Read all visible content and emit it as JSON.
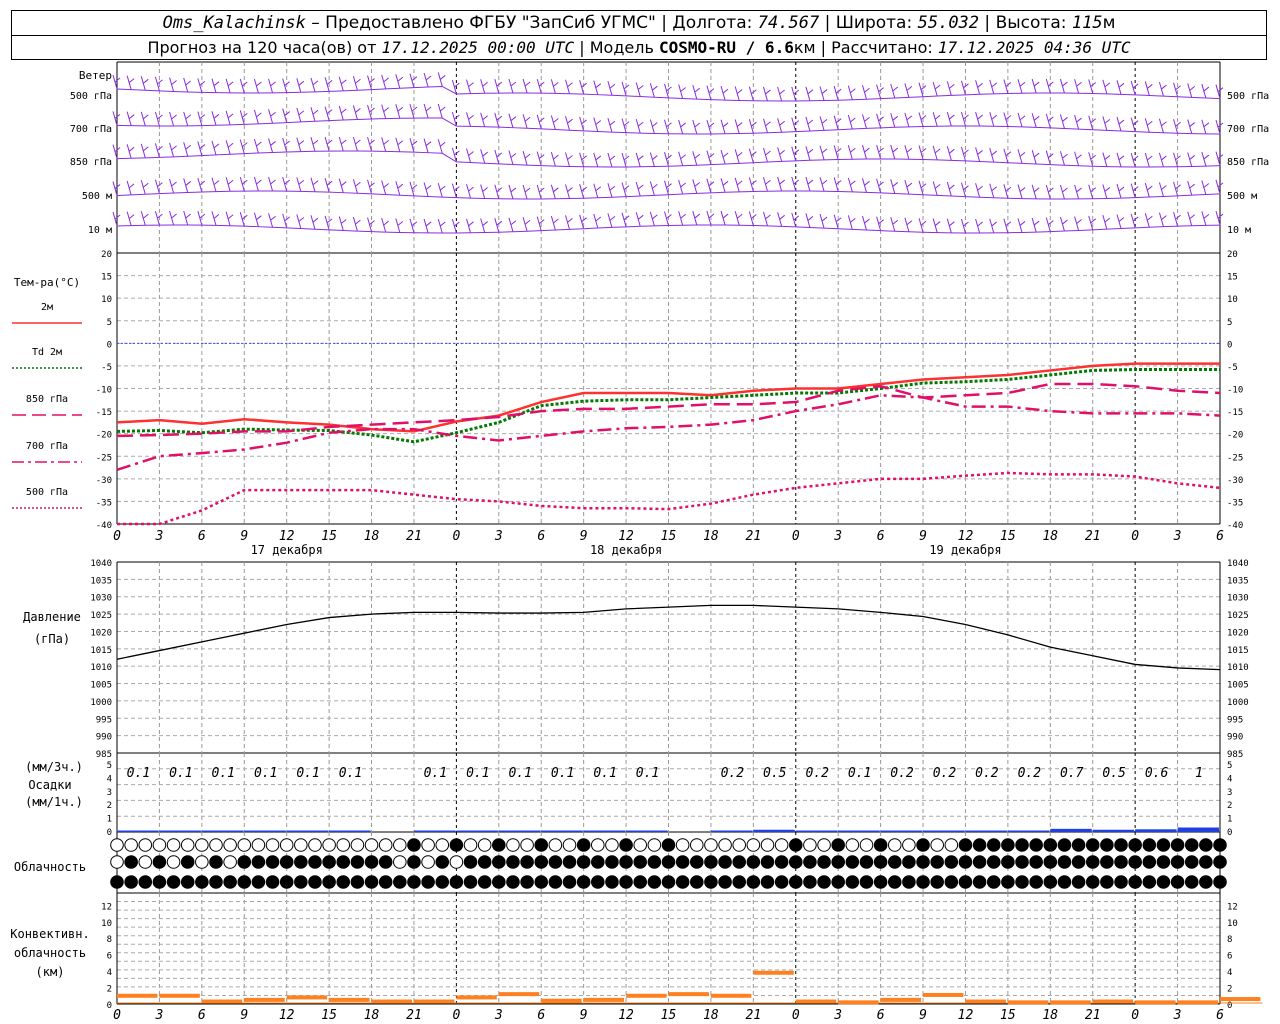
{
  "header": {
    "station": "Oms_Kalachinsk",
    "provider": "– Предоставлено ФГБУ \"ЗапСиб УГМС\"",
    "lon_label": "Долгота:",
    "lon": "74.567",
    "lat_label": "Широта:",
    "lat": "55.032",
    "alt_label": "Высота:",
    "alt": "115",
    "alt_unit": "м",
    "forecast_prefix": "Прогноз на 120 часа(ов) от",
    "forecast_start": "17.12.2025 00:00 UTC",
    "model_label": "Модель",
    "model": "COSMO-RU / 6.6",
    "model_unit": "км",
    "calc_label": "Рассчитано:",
    "calc_time": "17.12.2025 04:36 UTC"
  },
  "time_axis": {
    "hour_labels": [
      "0",
      "3",
      "6",
      "9",
      "12",
      "15",
      "18",
      "21",
      "0",
      "3",
      "6",
      "9",
      "12",
      "15",
      "18",
      "21",
      "0",
      "3",
      "6",
      "9",
      "12",
      "15",
      "18",
      "21",
      "0",
      "3",
      "6"
    ],
    "day_labels": [
      "17 декабря",
      "18 декабря",
      "19 декабря"
    ]
  },
  "wind_panel": {
    "title": "Ветер",
    "levels": [
      "500 гПа",
      "700 гПа",
      "850 гПа",
      "500 м",
      "10  м"
    ],
    "color": "#8a2be2"
  },
  "temp_panel": {
    "title": "Тем-ра(°C)",
    "legend": [
      {
        "label": "2м",
        "color": "#ff3030",
        "dash": "solid"
      },
      {
        "label": "Td 2м",
        "color": "#007a00",
        "dash": "dotted"
      },
      {
        "label": "850 гПа",
        "color": "#e0106a",
        "dash": "long-dash"
      },
      {
        "label": "700 гПа",
        "color": "#e0106a",
        "dash": "dash-dot"
      },
      {
        "label": "500 гПа",
        "color": "#e0106a",
        "dash": "dotted"
      }
    ],
    "yticks": [
      "20",
      "15",
      "10",
      "5",
      "0",
      "-5",
      "-10",
      "-15",
      "-20",
      "-25",
      "-30",
      "-35",
      "-40"
    ]
  },
  "pressure_panel": {
    "title": "Давление",
    "unit": "(гПа)",
    "yticks": [
      "1040",
      "1035",
      "1030",
      "1025",
      "1020",
      "1015",
      "1010",
      "1005",
      "1000",
      "995",
      "990",
      "985"
    ]
  },
  "precip_panel": {
    "unit3": "(мм/3ч.)",
    "title": "Осадки",
    "unit1": "(мм/1ч.)",
    "yticks": [
      "5",
      "4",
      "3",
      "2",
      "1",
      "0"
    ],
    "labels": [
      {
        "hour": 3,
        "text": "0.1"
      },
      {
        "hour": 6,
        "text": "0.1"
      },
      {
        "hour": 9,
        "text": "0.1"
      },
      {
        "hour": 12,
        "text": "0.1"
      },
      {
        "hour": 15,
        "text": "0.1"
      },
      {
        "hour": 18,
        "text": "0.1"
      },
      {
        "hour": 24,
        "text": "0.1"
      },
      {
        "hour": 27,
        "text": "0.1"
      },
      {
        "hour": 30,
        "text": "0.1"
      },
      {
        "hour": 33,
        "text": "0.1"
      },
      {
        "hour": 36,
        "text": "0.1"
      },
      {
        "hour": 39,
        "text": "0.1"
      },
      {
        "hour": 45,
        "text": "0.2"
      },
      {
        "hour": 48,
        "text": "0.5"
      },
      {
        "hour": 51,
        "text": "0.2"
      },
      {
        "hour": 54,
        "text": "0.1"
      },
      {
        "hour": 57,
        "text": "0.2"
      },
      {
        "hour": 60,
        "text": "0.2"
      },
      {
        "hour": 63,
        "text": "0.2"
      },
      {
        "hour": 66,
        "text": "0.2"
      },
      {
        "hour": 69,
        "text": "0.7"
      },
      {
        "hour": 72,
        "text": "0.5"
      },
      {
        "hour": 75,
        "text": "0.6"
      },
      {
        "hour": 78,
        "text": "1"
      }
    ],
    "bar_color": "#2040e0"
  },
  "cloud_panel": {
    "title": "Облачность"
  },
  "conv_panel": {
    "title1": "Конвективн.",
    "title2": "облачность",
    "unit": "(км)",
    "yticks": [
      "12",
      "10",
      "8",
      "6",
      "4",
      "2",
      "0"
    ],
    "color": "#ff8020"
  },
  "chart_data": {
    "type": "line",
    "x_unit": "hours from 17.12.2025 00:00 UTC",
    "x": [
      0,
      3,
      6,
      9,
      12,
      15,
      18,
      21,
      24,
      27,
      30,
      33,
      36,
      39,
      42,
      45,
      48,
      51,
      54,
      57,
      60,
      63,
      66,
      69,
      72,
      75,
      78
    ],
    "series": [
      {
        "name": "2м",
        "values": [
          -17.5,
          -17,
          -17.8,
          -16.8,
          -17.5,
          -18,
          -19,
          -19.5,
          -17.3,
          -16,
          -13,
          -11,
          -11,
          -11,
          -11.5,
          -10.5,
          -10,
          -10,
          -9,
          -8,
          -7.5,
          -7,
          -6,
          -5,
          -4.5,
          -4.5,
          -4.5
        ]
      },
      {
        "name": "Td 2м",
        "values": [
          -19.5,
          -19.3,
          -19.8,
          -19,
          -19.2,
          -19.3,
          -20.3,
          -21.8,
          -19.8,
          -17.5,
          -13.8,
          -12.8,
          -12.5,
          -12.5,
          -12,
          -11.5,
          -11,
          -11,
          -10,
          -8.8,
          -8.5,
          -8,
          -7,
          -6,
          -5.8,
          -5.8,
          -5.8
        ]
      },
      {
        "name": "850 гПа",
        "values": [
          -20.5,
          -20.3,
          -20,
          -19.5,
          -19.5,
          -18.5,
          -18,
          -17.5,
          -17,
          -16.3,
          -15,
          -14.5,
          -14.5,
          -14,
          -13.5,
          -13.5,
          -13,
          -10.5,
          -9.5,
          -12,
          -11.5,
          -11,
          -9,
          -9,
          -9.5,
          -10.5,
          -11
        ]
      },
      {
        "name": "700 гПа",
        "values": [
          -28,
          -25,
          -24.3,
          -23.5,
          -22,
          -19.8,
          -19,
          -19,
          -20.5,
          -21.5,
          -20.5,
          -19.5,
          -18.8,
          -18.5,
          -18,
          -17,
          -15,
          -13.5,
          -11.5,
          -12,
          -14,
          -14,
          -15,
          -15.5,
          -15.5,
          -15.5,
          -16
        ]
      },
      {
        "name": "500 гПа",
        "values": [
          -42,
          -40,
          -37,
          -32.5,
          -32.5,
          -32.5,
          -32.5,
          -33.5,
          -34.5,
          -35,
          -36,
          -36.5,
          -36.5,
          -36.7,
          -35.5,
          -33.5,
          -32,
          -31,
          -30,
          -30,
          -29.3,
          -28.7,
          -29,
          -29,
          -29.5,
          -31,
          -32
        ]
      },
      {
        "name": "Давление",
        "values": [
          1012,
          1014.5,
          1017,
          1019.5,
          1022,
          1024,
          1025,
          1025.5,
          1025.5,
          1025.3,
          1025.3,
          1025.5,
          1026.5,
          1027,
          1027.5,
          1027.5,
          1027,
          1026.5,
          1025.5,
          1024.3,
          1022,
          1019,
          1015.5,
          1013,
          1010.5,
          1009.5,
          1009
        ]
      }
    ],
    "precip_3h": [
      0.1,
      0.1,
      0.1,
      0.1,
      0.1,
      0.1,
      0,
      0.1,
      0.1,
      0.1,
      0.1,
      0.1,
      0.1,
      0,
      0.2,
      0.5,
      0.2,
      0.1,
      0.2,
      0.2,
      0.2,
      0.2,
      0.7,
      0.5,
      0.6,
      1
    ],
    "cloud_cover_rows": {
      "upper": "mostly clear (white discs) with partial cover on day 2-3",
      "middle": "partial to overcast",
      "lower": "overcast (black discs)"
    },
    "convective_cloud_km_hours": [
      1,
      1,
      0.3,
      0.5,
      0.8,
      0.5,
      0.3,
      0.3,
      0.8,
      1.2,
      0.4,
      0.5,
      1,
      1.2,
      1,
      3.8,
      0.3,
      0.2,
      0.5,
      1.1,
      0.3,
      0.2,
      0.2,
      0.3,
      0.2,
      0.2,
      0.6
    ],
    "ylim_temp": [
      -40,
      20
    ],
    "ylim_pressure": [
      985,
      1040
    ],
    "ylim_precip": [
      0,
      5
    ],
    "ylim_conv": [
      0,
      13
    ],
    "grid": true
  }
}
